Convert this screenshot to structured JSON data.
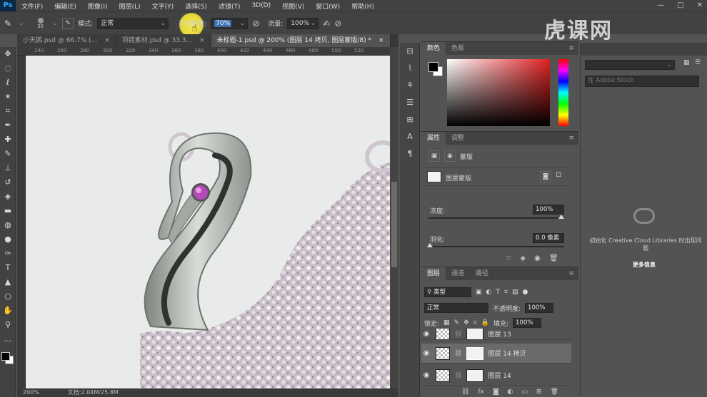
{
  "app": {
    "logo": "Ps"
  },
  "menu": [
    "文件(F)",
    "编辑(E)",
    "图像(I)",
    "图层(L)",
    "文字(Y)",
    "选择(S)",
    "滤镜(T)",
    "3D(D)",
    "视图(V)",
    "窗口(W)",
    "帮助(H)"
  ],
  "window_controls": [
    "—",
    "□",
    "✕"
  ],
  "options": {
    "brush_size": "30",
    "mode_label": "模式:",
    "mode_value": "正常",
    "opacity_label": "不透明度:",
    "opacity_value": "70%",
    "flow_label": "流量:",
    "flow_value": "100%"
  },
  "tabs": [
    {
      "label": "小天鹅.psd @ 66.7% (...",
      "close": "×"
    },
    {
      "label": "项链素材.psd @ 33.3...",
      "close": "×"
    },
    {
      "label": "未标题-1.psd @ 200% (图层 14 拷贝, 图层蒙版/8) *",
      "close": "×"
    }
  ],
  "ruler_ticks": [
    "240",
    "260",
    "280",
    "300",
    "320",
    "340",
    "360",
    "380",
    "400",
    "420",
    "440",
    "460",
    "480",
    "500",
    "520"
  ],
  "status": {
    "zoom": "200%",
    "doc": "文档:2.04M/25.8M"
  },
  "color_panel": {
    "tabs": [
      "颜色",
      "色板"
    ],
    "hue_bar_colors": [
      "#ff0000",
      "#ff00ff",
      "#0000ff",
      "#00ffff",
      "#00ff00",
      "#ffff00",
      "#ff0000"
    ],
    "base_hue": "#e02020"
  },
  "properties_panel": {
    "tabs": [
      "属性",
      "调整"
    ],
    "section": "蒙版",
    "layer_mask_label": "图层蒙版",
    "density_label": "浓度:",
    "density_value": "100%",
    "feather_label": "羽化:",
    "feather_value": "0.0 像素"
  },
  "layers_panel": {
    "tabs": [
      "图层",
      "通道",
      "路径"
    ],
    "filter_label": "类型",
    "blend_mode": "正常",
    "opacity_label": "不透明度:",
    "opacity_value": "100%",
    "lock_label": "锁定:",
    "fill_label": "填充:",
    "fill_value": "100%",
    "layers": [
      {
        "name": "图层 13",
        "selected": false
      },
      {
        "name": "图层 14 拷贝",
        "selected": true
      },
      {
        "name": "图层 14",
        "selected": false
      }
    ],
    "footer_icons": [
      "link-icon",
      "fx-icon",
      "mask-icon",
      "adjustment-icon",
      "folder-icon",
      "new-layer-icon",
      "trash-icon"
    ]
  },
  "library_panel": {
    "search_placeholder": "在 Adobe Stock",
    "message": "初始化 Creative Cloud Libraries 时出现问题",
    "more_link": "更多信息"
  },
  "watermark": "虎课网"
}
